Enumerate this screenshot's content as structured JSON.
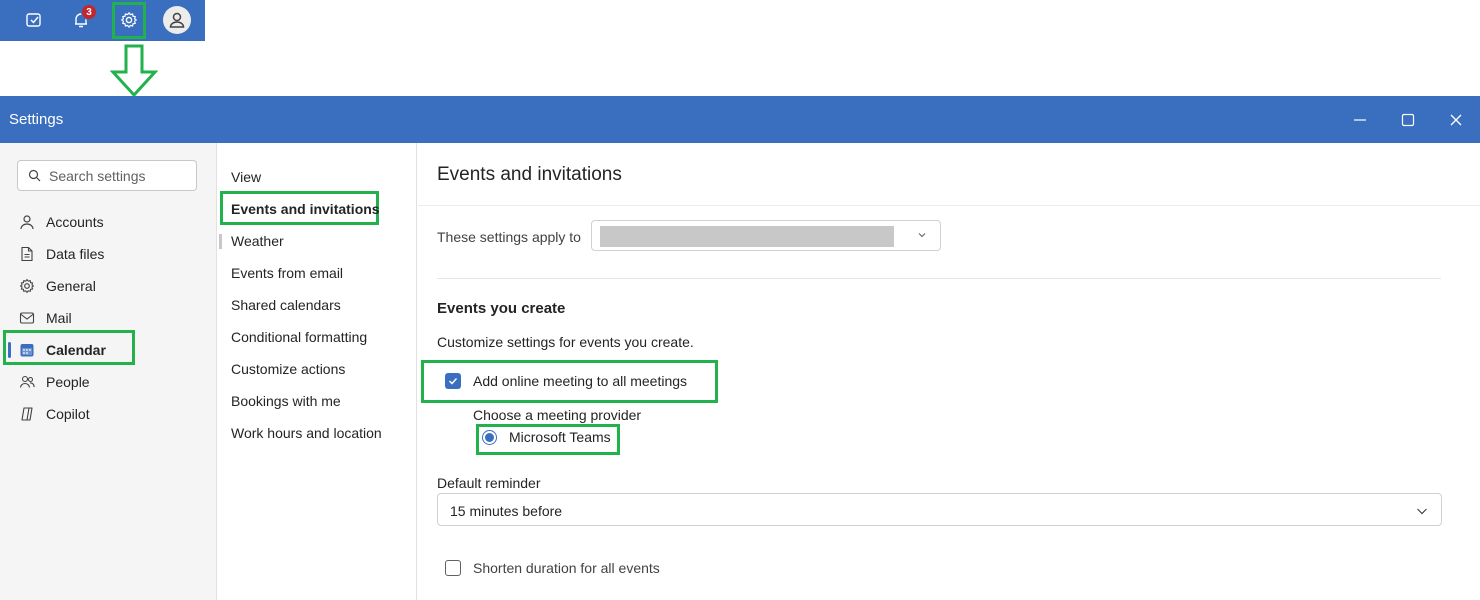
{
  "topbar": {
    "icons": [
      "my-day-icon",
      "bell-icon",
      "gear-icon",
      "avatar-icon"
    ],
    "notification_count": "3"
  },
  "window": {
    "title": "Settings",
    "controls": [
      "minimize-icon",
      "maximize-icon",
      "close-icon"
    ]
  },
  "search": {
    "placeholder": "Search settings"
  },
  "nav": {
    "items": [
      {
        "label": "Accounts",
        "icon": "person-icon"
      },
      {
        "label": "Data files",
        "icon": "document-icon"
      },
      {
        "label": "General",
        "icon": "gear-icon"
      },
      {
        "label": "Mail",
        "icon": "mail-icon"
      },
      {
        "label": "Calendar",
        "icon": "calendar-icon",
        "active": true
      },
      {
        "label": "People",
        "icon": "people-icon"
      },
      {
        "label": "Copilot",
        "icon": "copilot-icon"
      }
    ]
  },
  "subnav": {
    "items": [
      {
        "label": "View"
      },
      {
        "label": "Events and invitations",
        "active": true
      },
      {
        "label": "Weather"
      },
      {
        "label": "Events from email"
      },
      {
        "label": "Shared calendars"
      },
      {
        "label": "Conditional formatting"
      },
      {
        "label": "Customize actions"
      },
      {
        "label": "Bookings with me"
      },
      {
        "label": "Work hours and location"
      }
    ]
  },
  "main": {
    "heading": "Events and invitations",
    "apply_label": "These settings apply to",
    "section_title": "Events you create",
    "section_desc": "Customize settings for events you create.",
    "online_meeting_label": "Add online meeting to all meetings",
    "online_meeting_checked": true,
    "provider_label": "Choose a meeting provider",
    "provider_option": "Microsoft Teams",
    "reminder_label": "Default reminder",
    "reminder_value": "15 minutes before",
    "shorten_label": "Shorten duration for all events",
    "shorten_checked": false
  },
  "colors": {
    "accent": "#3a6fbf",
    "highlight": "#22b14c",
    "badge": "#c4262e"
  }
}
